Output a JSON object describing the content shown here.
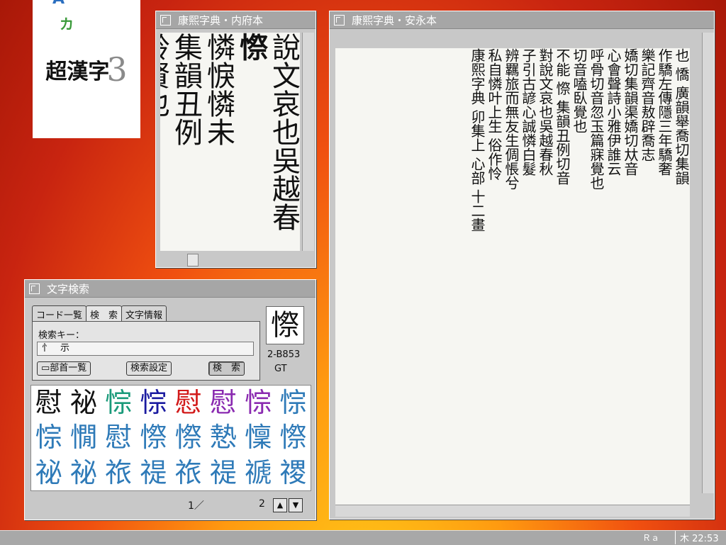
{
  "logo": {
    "main": "超漢字",
    "accent_a": "A",
    "accent_ka": "カ",
    "version": "3"
  },
  "window_naifu": {
    "title": "康熙字典・内府本",
    "columns": [
      "說文哀也吳越春",
      "憐悷憐未",
      "集韻丑例",
      "聆賢也"
    ],
    "headword": "憏"
  },
  "window_anei": {
    "title": "康熙字典・安永本",
    "columns": [
      "也 憍 廣韻舉喬切集韻",
      "作驕左傳隱三年驕奢",
      "樂記齊音敖辟喬志",
      "嬌切集韻渠嬌切夶音",
      "心會聲詩小雅伊誰云",
      "呼骨切音忽玉篇寐覺也",
      "切音嗑臥覺也",
      "不能 憏 集韻丑例切音",
      "對說文哀也吳越春秋",
      "子引古諺心誠憐白髮",
      "辨羈旅而無友生倜悵兮",
      "私自憐叶上生 俗作怜",
      "康熙字典 卯集上 心部 十二畫"
    ]
  },
  "search_window": {
    "title": "文字検索",
    "tabs": [
      "コード一覧",
      "検　索",
      "文字情報"
    ],
    "key_label": "検索キー：",
    "key_value": "忄　示",
    "btn_radicals": "▭部首一覧",
    "btn_settings": "検索設定",
    "btn_search": "検　索",
    "preview_char": "憏",
    "code": "2-B853",
    "code_set": "GT",
    "results": [
      {
        "ch": "慰",
        "color": "#111111"
      },
      {
        "ch": "祕",
        "color": "#111111"
      },
      {
        "ch": "悰",
        "color": "#1a9a7a"
      },
      {
        "ch": "悰",
        "color": "#1a1aa0"
      },
      {
        "ch": "慰",
        "color": "#d21a1a"
      },
      {
        "ch": "慰",
        "color": "#8a2ab0"
      },
      {
        "ch": "悰",
        "color": "#8a2ab0"
      },
      {
        "ch": "悰",
        "color": "#2e7ab8"
      },
      {
        "ch": "悰",
        "color": "#2e7ab8"
      },
      {
        "ch": "憪",
        "color": "#2e7ab8"
      },
      {
        "ch": "慰",
        "color": "#2e7ab8"
      },
      {
        "ch": "憏",
        "color": "#2e7ab8"
      },
      {
        "ch": "憏",
        "color": "#2e7ab8"
      },
      {
        "ch": "慹",
        "color": "#2e7ab8"
      },
      {
        "ch": "懍",
        "color": "#2e7ab8"
      },
      {
        "ch": "憏",
        "color": "#2e7ab8"
      },
      {
        "ch": "祕",
        "color": "#2e7ab8"
      },
      {
        "ch": "祕",
        "color": "#2e7ab8"
      },
      {
        "ch": "祣",
        "color": "#2e7ab8"
      },
      {
        "ch": "禔",
        "color": "#2e7ab8"
      },
      {
        "ch": "祣",
        "color": "#2e7ab8"
      },
      {
        "ch": "禔",
        "color": "#2e7ab8"
      },
      {
        "ch": "禠",
        "color": "#2e7ab8"
      },
      {
        "ch": "禝",
        "color": "#2e7ab8"
      }
    ],
    "page_current": "1／",
    "page_total": "2",
    "up_arrow": "▲",
    "down_arrow": "▼"
  },
  "taskbar": {
    "ime": "Ｒａ",
    "clock": "木 22:53"
  },
  "colors": {
    "titlebar": "#a6a6a6",
    "window": "#c8c8c8",
    "taskbar": "#a8a8a8"
  }
}
